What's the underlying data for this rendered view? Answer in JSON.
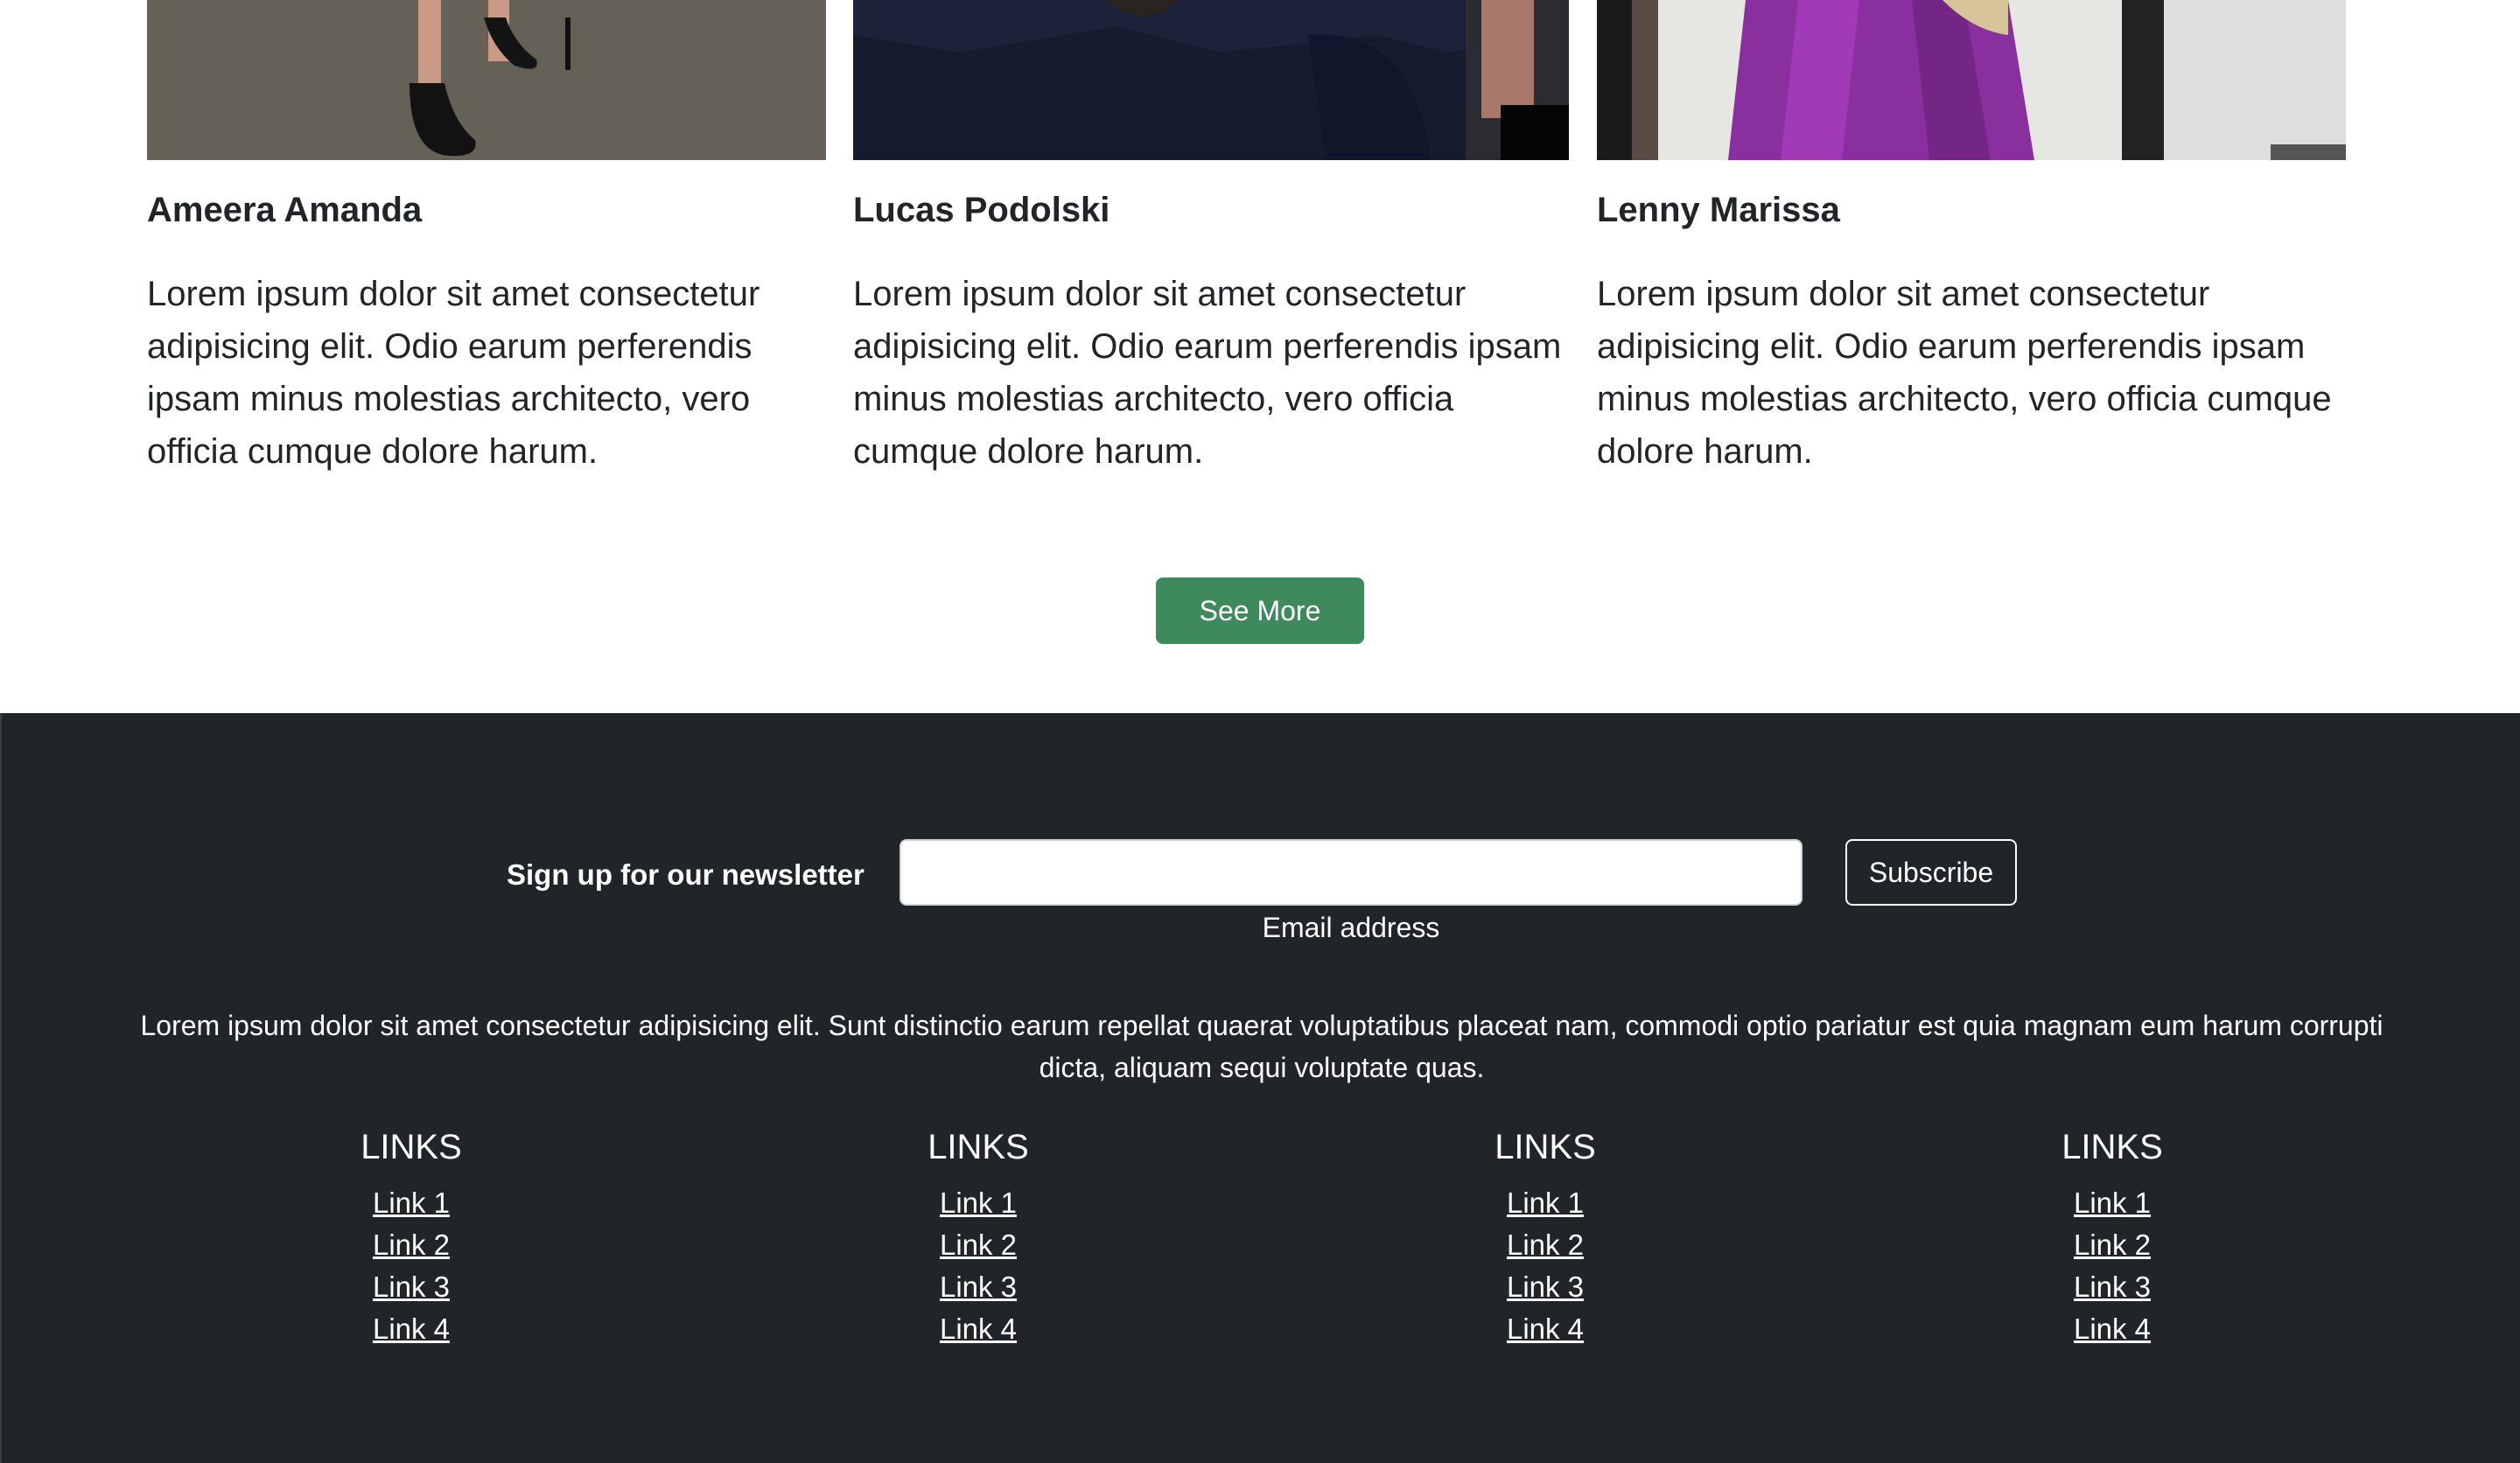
{
  "team": {
    "members": [
      {
        "name": "Ameera Amanda",
        "bio": "Lorem ipsum dolor sit amet consectetur adipisicing elit. Odio earum perferendis ipsam minus molestias architecto, vero officia cumque dolore harum.",
        "photo_icon": "person-photo-heels-on-carpet"
      },
      {
        "name": "Lucas Podolski",
        "bio": "Lorem ipsum dolor sit amet consectetur adipisicing elit. Odio earum perferendis ipsam minus molestias architecto, vero officia cumque dolore harum.",
        "photo_icon": "person-photo-navy-trousers"
      },
      {
        "name": "Lenny Marissa",
        "bio": "Lorem ipsum dolor sit amet consectetur adipisicing elit. Odio earum perferendis ipsam minus molestias architecto, vero officia cumque dolore harum.",
        "photo_icon": "person-photo-purple-dress"
      }
    ],
    "see_more_label": "See More"
  },
  "footer": {
    "newsletter_label": "Sign up for our newsletter",
    "email_placeholder": "",
    "email_help": "Email address",
    "subscribe_label": "Subscribe",
    "text": "Lorem ipsum dolor sit amet consectetur adipisicing elit. Sunt distinctio earum repellat quaerat voluptatibus placeat nam, commodi optio pariatur est quia magnam eum harum corrupti dicta, aliquam sequi voluptate quas.",
    "link_columns": [
      {
        "heading": "LINKS",
        "links": [
          "Link 1",
          "Link 2",
          "Link 3",
          "Link 4"
        ]
      },
      {
        "heading": "LINKS",
        "links": [
          "Link 1",
          "Link 2",
          "Link 3",
          "Link 4"
        ]
      },
      {
        "heading": "LINKS",
        "links": [
          "Link 1",
          "Link 2",
          "Link 3",
          "Link 4"
        ]
      },
      {
        "heading": "LINKS",
        "links": [
          "Link 1",
          "Link 2",
          "Link 3",
          "Link 4"
        ]
      }
    ]
  },
  "colors": {
    "accent_button": "#3f8a5c",
    "footer_bg": "#212529",
    "text": "#212529"
  }
}
